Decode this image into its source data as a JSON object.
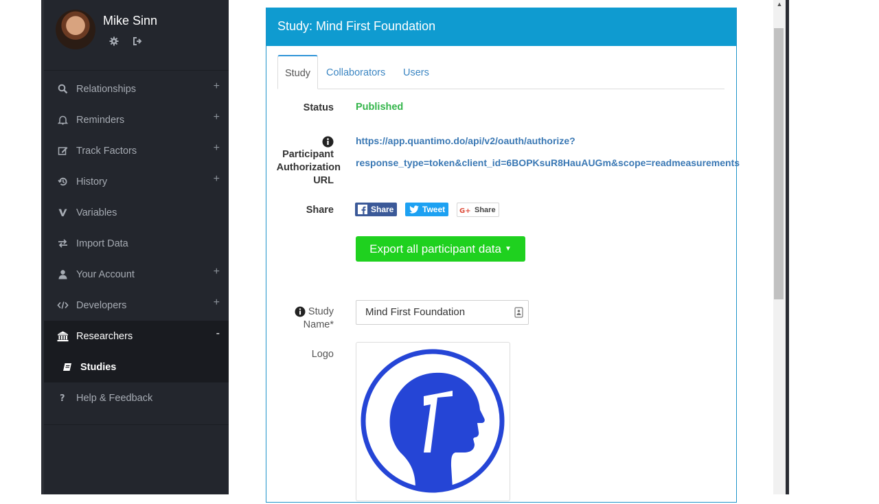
{
  "user": {
    "name": "Mike Sinn"
  },
  "sidebar": {
    "items": [
      {
        "label": "Relationships",
        "icon": "search-icon",
        "expand": "+"
      },
      {
        "label": "Reminders",
        "icon": "bell-icon",
        "expand": "+"
      },
      {
        "label": "Track Factors",
        "icon": "edit-icon",
        "expand": "+"
      },
      {
        "label": "History",
        "icon": "history-icon",
        "expand": "+"
      },
      {
        "label": "Variables",
        "icon": "variables-icon"
      },
      {
        "label": "Import Data",
        "icon": "exchange-icon"
      },
      {
        "label": "Your Account",
        "icon": "user-icon",
        "expand": "+"
      },
      {
        "label": "Developers",
        "icon": "code-icon",
        "expand": "+"
      },
      {
        "label": "Researchers",
        "icon": "institution-icon",
        "expand": "-"
      },
      {
        "label": "Studies",
        "icon": "book-icon"
      },
      {
        "label": "Help & Feedback",
        "icon": "question-icon"
      }
    ]
  },
  "card": {
    "title": "Study: Mind First Foundation"
  },
  "tabs": [
    {
      "label": "Study"
    },
    {
      "label": "Collaborators"
    },
    {
      "label": "Users"
    }
  ],
  "fields": {
    "status_label": "Status",
    "status_value": "Published",
    "url_label_1": "Participant",
    "url_label_2": "Authorization",
    "url_label_3": "URL",
    "url_line_1": "https://app.quantimo.do/api/v2/oauth/authorize?",
    "url_line_2": "response_type=token&client_id=6BOPKsuR8HauAUGm&scope=readmeasurements",
    "share_label": "Share",
    "share_facebook": "Share",
    "share_twitter": "Tweet",
    "share_google": "Share",
    "export_button": "Export all participant data",
    "study_name_label_1": "Study",
    "study_name_label_2": "Name*",
    "study_name_value": "Mind First Foundation",
    "logo_label": "Logo"
  },
  "colors": {
    "accent": "#0f9bd0",
    "export": "#1fd11f",
    "published": "#33b54a",
    "logo_blue": "#2545d6"
  }
}
